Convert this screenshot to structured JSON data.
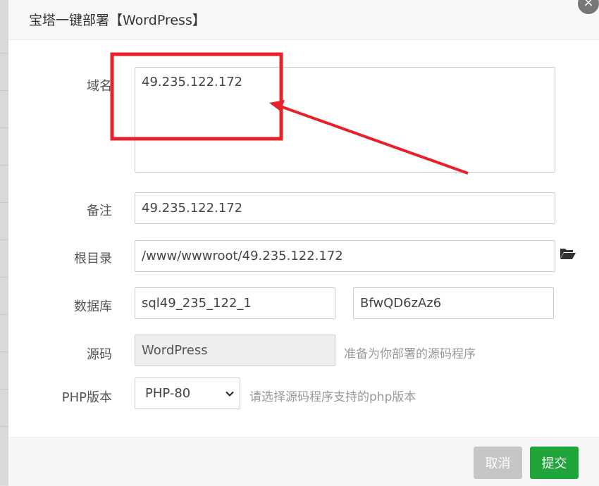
{
  "dialog": {
    "title": "宝塔一键部署【WordPress】"
  },
  "form": {
    "domain": {
      "label": "域名",
      "value": "49.235.122.172"
    },
    "remark": {
      "label": "备注",
      "value": "49.235.122.172"
    },
    "root_dir": {
      "label": "根目录",
      "value": "/www/wwwroot/49.235.122.172",
      "icon": "folder-open-icon"
    },
    "database": {
      "label": "数据库",
      "name": "sql49_235_122_1",
      "password": "BfwQD6zAz6"
    },
    "source": {
      "label": "源码",
      "value": "WordPress",
      "hint": "准备为你部署的源码程序"
    },
    "php": {
      "label": "PHP版本",
      "selected": "PHP-80",
      "hint": "请选择源码程序支持的php版本"
    }
  },
  "buttons": {
    "cancel": "取消",
    "submit": "提交"
  },
  "colors": {
    "submit": "#20a53a",
    "cancel": "#c6c6c6",
    "annotation": "#e8202a"
  }
}
